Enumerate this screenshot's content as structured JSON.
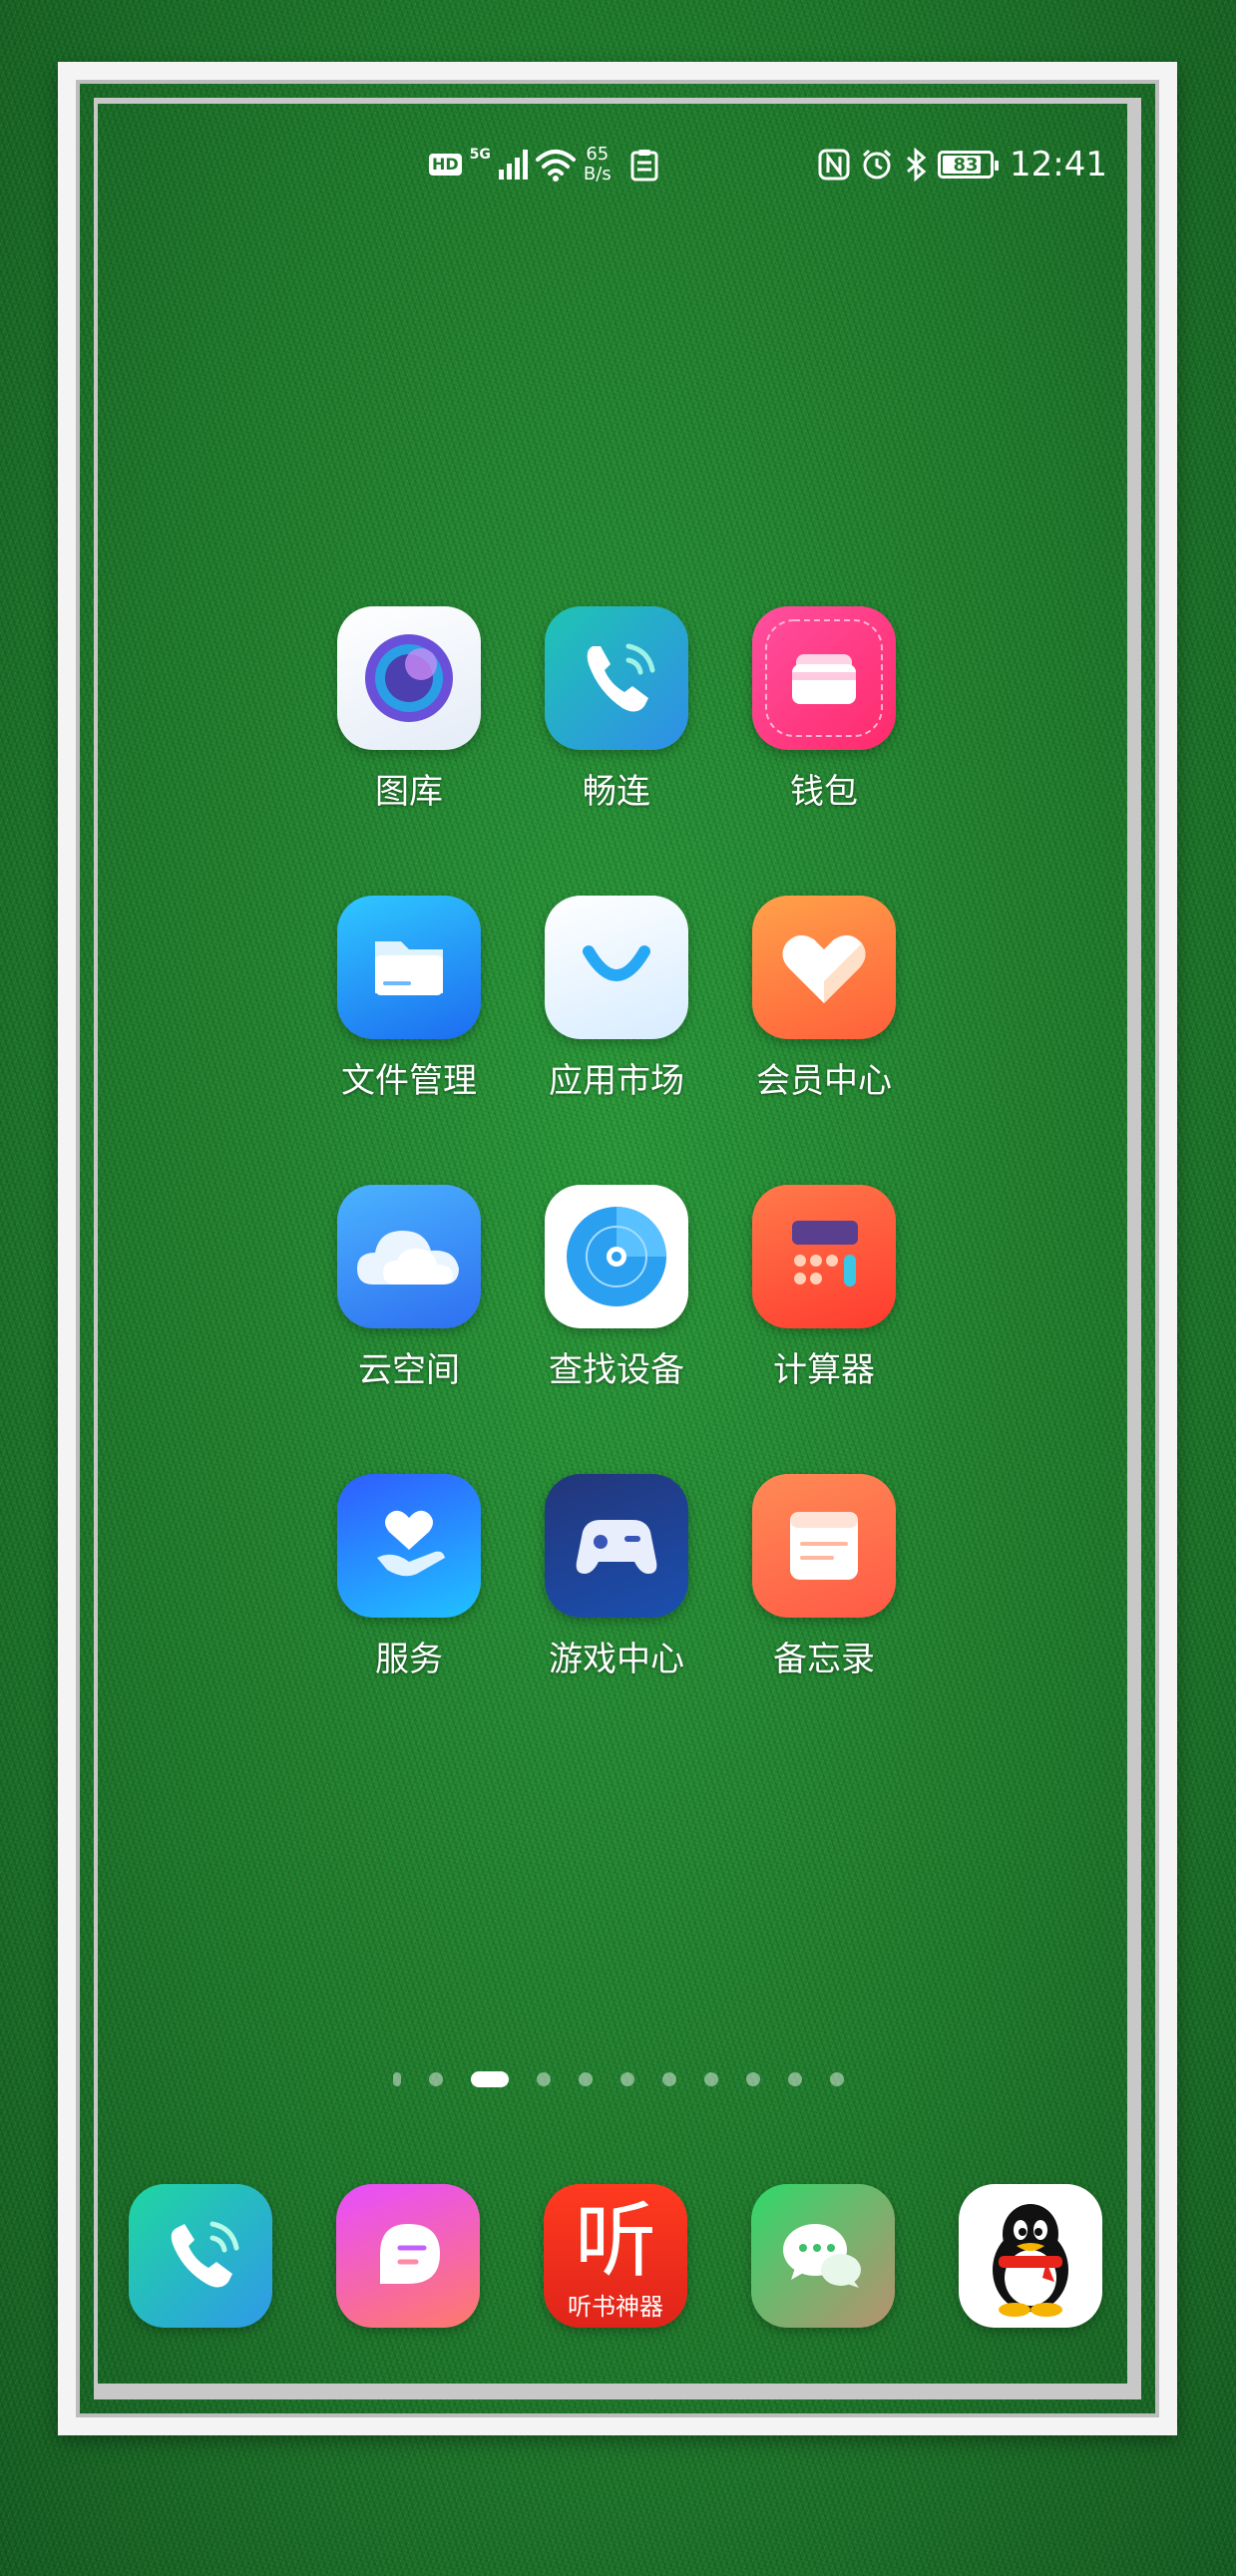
{
  "status_bar": {
    "hd": "HD",
    "network_type": "5G",
    "speed_value": "65",
    "speed_unit": "B/s",
    "battery": "83",
    "time": "12:41"
  },
  "apps": [
    {
      "label": "图库",
      "icon": "gallery-icon"
    },
    {
      "label": "畅连",
      "icon": "meetime-icon"
    },
    {
      "label": "钱包",
      "icon": "wallet-icon"
    },
    {
      "label": "文件管理",
      "icon": "files-icon"
    },
    {
      "label": "应用市场",
      "icon": "app-market-icon"
    },
    {
      "label": "会员中心",
      "icon": "member-center-icon"
    },
    {
      "label": "云空间",
      "icon": "cloud-icon"
    },
    {
      "label": "查找设备",
      "icon": "find-device-icon"
    },
    {
      "label": "计算器",
      "icon": "calculator-icon"
    },
    {
      "label": "服务",
      "icon": "services-icon"
    },
    {
      "label": "游戏中心",
      "icon": "game-center-icon"
    },
    {
      "label": "备忘录",
      "icon": "notepad-icon"
    }
  ],
  "page_indicator": {
    "pages": 11,
    "current": 3
  },
  "dock": [
    {
      "icon": "phone-icon"
    },
    {
      "icon": "messages-icon"
    },
    {
      "icon": "audiobook-icon",
      "text_main": "听",
      "text_sub": "听书神器"
    },
    {
      "icon": "wechat-icon"
    },
    {
      "icon": "qq-icon"
    }
  ],
  "colors": {
    "wallpaper": "#1f7a2c",
    "frame": "#f4f4f4"
  }
}
